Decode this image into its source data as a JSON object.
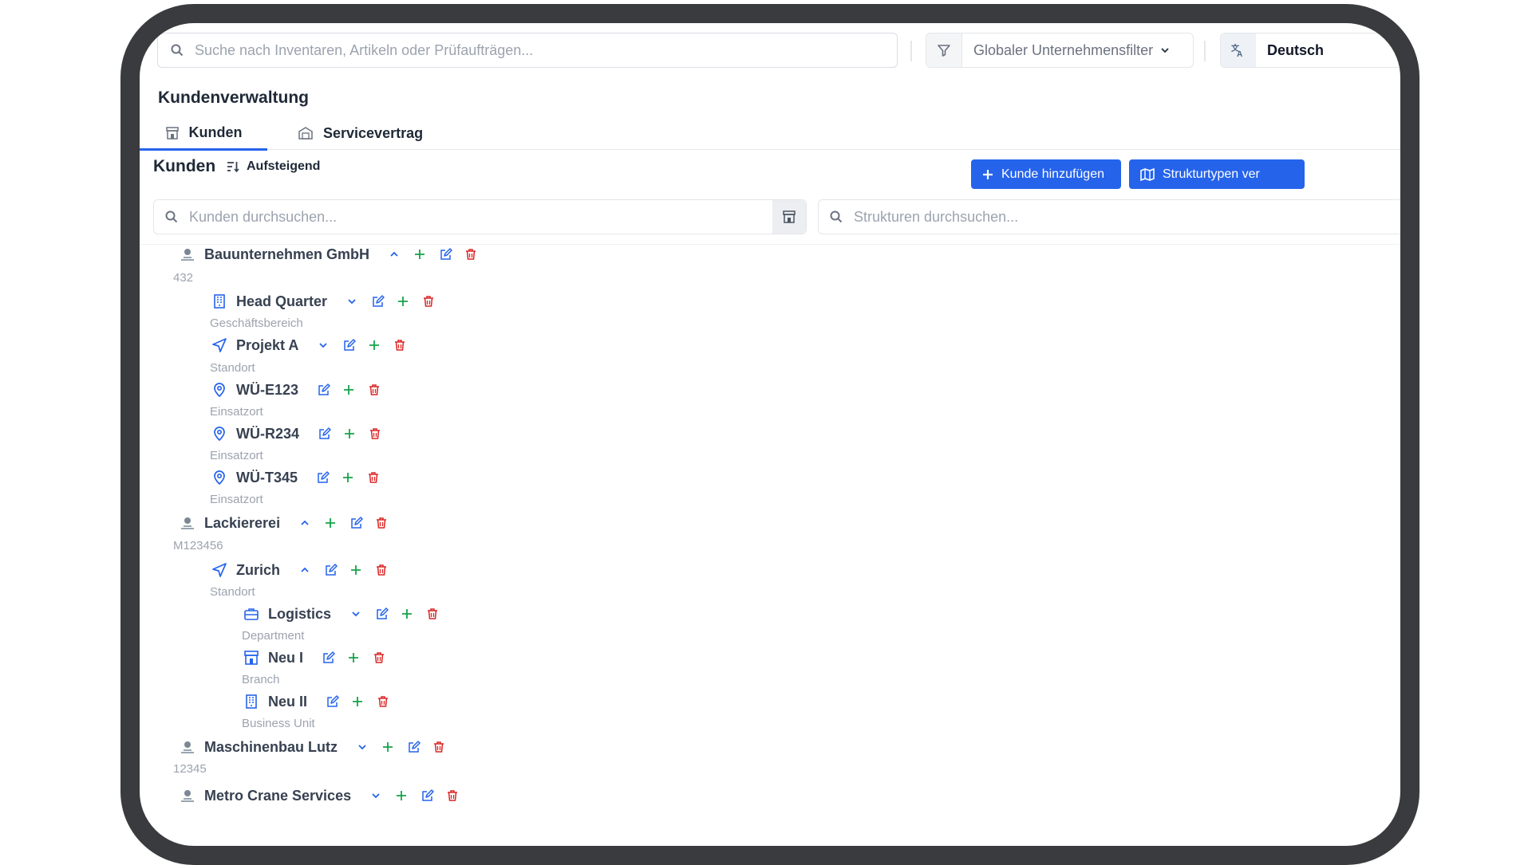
{
  "search": {
    "placeholder": "Suche nach Inventaren, Artikeln oder Prüfaufträgen..."
  },
  "filter": {
    "label": "Globaler Unternehmensfilter"
  },
  "language": {
    "label": "Deutsch"
  },
  "page_title": "Kundenverwaltung",
  "tabs": [
    {
      "label": "Kunden",
      "active": true
    },
    {
      "label": "Servicevertrag",
      "active": false
    }
  ],
  "section": {
    "title": "Kunden",
    "sort_label": "Aufsteigend"
  },
  "buttons": {
    "add_customer": "Kunde hinzufügen",
    "structure_types": "Strukturtypen ver"
  },
  "customer_search": {
    "placeholder": "Kunden durchsuchen..."
  },
  "structure_search": {
    "placeholder": "Strukturen durchsuchen..."
  },
  "colors": {
    "accent": "#2563eb",
    "add": "#16a34a",
    "edit": "#2563eb",
    "delete": "#dc2626"
  },
  "tree": [
    {
      "name": "Bauunternehmen GmbH",
      "sub": "432",
      "icon": "customer-logo-icon",
      "expanded": true
    },
    {
      "name": "Head Quarter",
      "sub": "Geschäftsbereich",
      "icon": "building-icon",
      "expanded": false
    },
    {
      "name": "Projekt A",
      "sub": "Standort",
      "icon": "navigation-icon",
      "expanded": false
    },
    {
      "name": "WÜ-E123",
      "sub": "Einsatzort",
      "icon": "map-pin-icon"
    },
    {
      "name": "WÜ-R234",
      "sub": "Einsatzort",
      "icon": "map-pin-icon"
    },
    {
      "name": "WÜ-T345",
      "sub": "Einsatzort",
      "icon": "map-pin-icon"
    },
    {
      "name": "Lackiererei",
      "sub": "M123456",
      "icon": "customer-logo-icon",
      "expanded": true
    },
    {
      "name": "Zurich",
      "sub": "Standort",
      "icon": "navigation-icon",
      "expanded": true
    },
    {
      "name": "Logistics",
      "sub": "Department",
      "icon": "briefcase-icon",
      "expanded": false
    },
    {
      "name": "Neu I",
      "sub": "Branch",
      "icon": "store-icon"
    },
    {
      "name": "Neu II",
      "sub": "Business Unit",
      "icon": "building-icon"
    },
    {
      "name": "Maschinenbau Lutz",
      "sub": "12345",
      "icon": "customer-logo-icon",
      "expanded": false
    },
    {
      "name": "Metro Crane Services",
      "sub": "",
      "icon": "customer-logo-icon",
      "expanded": false
    }
  ]
}
